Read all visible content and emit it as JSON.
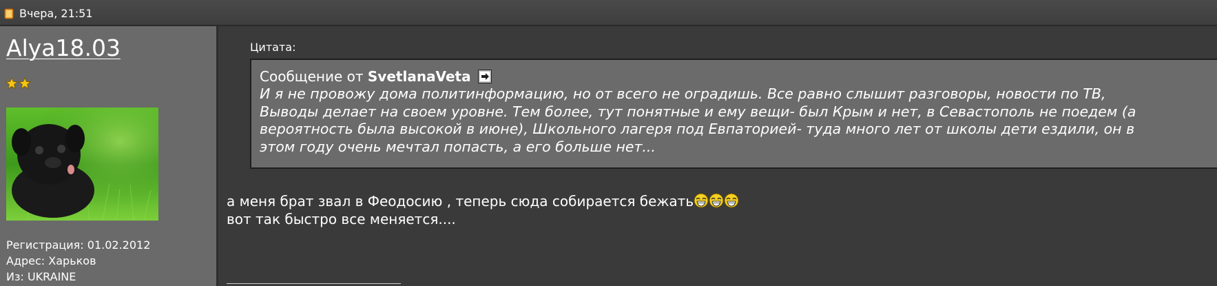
{
  "post": {
    "date": "Вчера, 21:51",
    "date_icon": "post-icon"
  },
  "user": {
    "name": "Alya18.03",
    "rank_stars": 2,
    "avatar_desc_icon": "avatar-image",
    "registration": "Регистрация: 01.02.2012",
    "address": "Адрес: Харьков",
    "from": "Из: UKRAINE"
  },
  "quote": {
    "label": "Цитата:",
    "prefix": "Сообщение от",
    "author": "SvetlanaVeta",
    "lines": [
      "И я не провожу дома политинформацию, но от всего не оградишь. Все равно слышит разговоры, новости по ТВ,",
      "Выводы делает на своем уровне. Тем более, тут понятные и ему вещи- был Крым и нет, в Севастополь не поедем (а",
      "вероятность была высокой в июне), Школьного лагеря под Евпаторией- туда много лет от школы дети ездили, он в",
      "этом году очень мечтал попасть, а его больше нет..."
    ]
  },
  "message": {
    "line1": "а меня брат звал в Феодосию , теперь сюда собирается бежать",
    "line2": "вот так быстро все меняется....",
    "smiley_count": 3
  }
}
